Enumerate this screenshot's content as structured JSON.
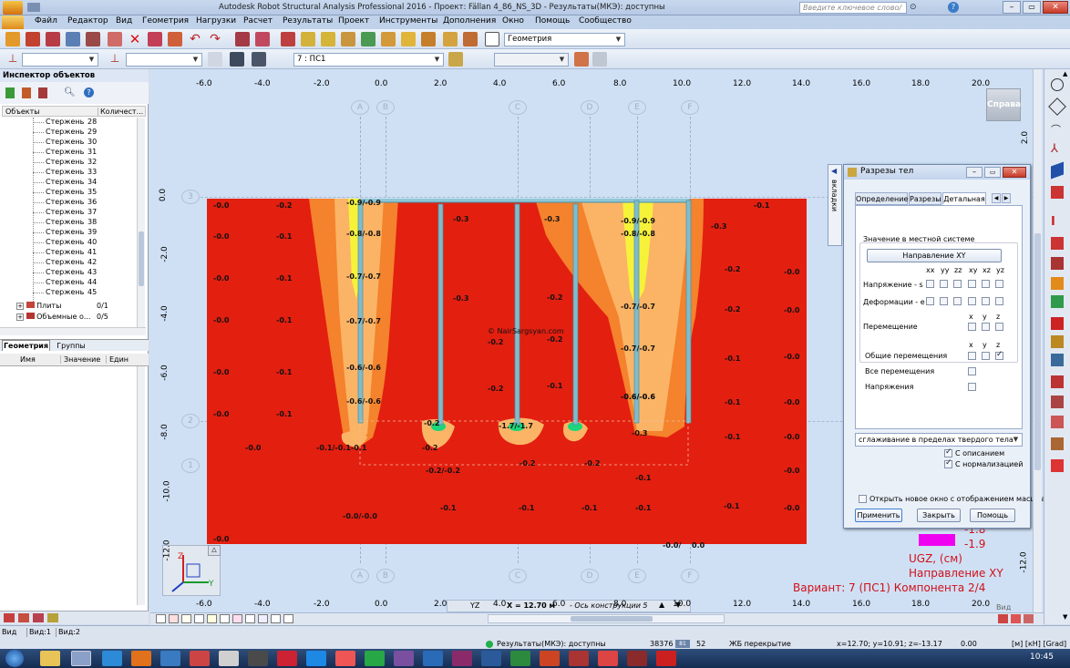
{
  "window": {
    "title": "Autodesk Robot Structural Analysis Professional 2016 - Проект: Fällan 4_86_NS_3D - Результаты(МКЭ): доступны",
    "help_placeholder": "Введите ключевое слово/фразу"
  },
  "menu": [
    "Файл",
    "Редактор",
    "Вид",
    "Геометрия",
    "Нагрузки",
    "Расчет",
    "Результаты",
    "Проект",
    "Инструменты",
    "Дополнения",
    "Окно",
    "Помощь",
    "Сообщество"
  ],
  "toolbar": {
    "layout_combo": "Геометрия",
    "case_combo": "7 : ПС1"
  },
  "inspector": {
    "title": "Инспектор объектов",
    "col_objects": "Объекты",
    "col_count": "Количест...",
    "bars": [
      {
        "label": "Стержень",
        "num": "28"
      },
      {
        "label": "Стержень",
        "num": "29"
      },
      {
        "label": "Стержень",
        "num": "30"
      },
      {
        "label": "Стержень",
        "num": "31"
      },
      {
        "label": "Стержень",
        "num": "32"
      },
      {
        "label": "Стержень",
        "num": "33"
      },
      {
        "label": "Стержень",
        "num": "34"
      },
      {
        "label": "Стержень",
        "num": "35"
      },
      {
        "label": "Стержень",
        "num": "36"
      },
      {
        "label": "Стержень",
        "num": "37"
      },
      {
        "label": "Стержень",
        "num": "38"
      },
      {
        "label": "Стержень",
        "num": "39"
      },
      {
        "label": "Стержень",
        "num": "40"
      },
      {
        "label": "Стержень",
        "num": "41"
      },
      {
        "label": "Стержень",
        "num": "42"
      },
      {
        "label": "Стержень",
        "num": "43"
      },
      {
        "label": "Стержень",
        "num": "44"
      },
      {
        "label": "Стержень",
        "num": "45"
      }
    ],
    "plates": {
      "label": "Плиты",
      "count": "0/1"
    },
    "solids": {
      "label": "Объемные о...",
      "count": "0/5"
    },
    "tab_geometry": "Геометрия",
    "tab_groups": "Группы",
    "prop_name": "Имя",
    "prop_value": "Значение",
    "prop_unit": "Един"
  },
  "viewport": {
    "top_ticks": [
      "-6.0",
      "-4.0",
      "-2.0",
      "0.0",
      "2.0",
      "4.0",
      "6.0",
      "8.0",
      "10.0",
      "12.0",
      "14.0",
      "16.0",
      "18.0",
      "20.0"
    ],
    "bottom_ticks": [
      "-6.0",
      "-4.0",
      "-2.0",
      "0.0",
      "2.0",
      "4.0",
      "6.0",
      "8.0",
      "10.0",
      "12.0",
      "14.0",
      "16.0",
      "18.0",
      "20.0"
    ],
    "left_ticks": [
      "0.0",
      "-2.0",
      "-4.0",
      "-6.0",
      "-8.0",
      "-10.0",
      "-12.0"
    ],
    "right_ticks": [
      "2.0",
      "-12.0"
    ],
    "grid_letters": [
      "A",
      "B",
      "C",
      "D",
      "E",
      "F"
    ],
    "grid_numbers": [
      "3",
      "2",
      "1"
    ],
    "view_cube": "Справа",
    "watermark": "© NairSargsyan.com",
    "status_plane": "YZ",
    "status_x": "X = 12.70 м",
    "status_axis": "- Ось конструкции 5",
    "view_label": "Вид",
    "values": [
      "-0.0",
      "-0.2",
      "-0.9/-0.9",
      "-0.3",
      "-0.3",
      "-0.9/-0.9",
      "-0.3",
      "-0.1",
      "-0.0",
      "-0.1",
      "-0.8/-0.8",
      "-0.8/-0.8",
      "-0.2",
      "-0.0",
      "-0.0",
      "-0.1",
      "-0.7/-0.7",
      "-0.3",
      "-0.2",
      "-0.7/-0.7",
      "-0.2",
      "-0.0",
      "-0.0",
      "-0.1",
      "-0.7/-0.7",
      "-0.2",
      "-0.2",
      "-0.7/-0.7",
      "-0.1",
      "-0.0",
      "-0.0",
      "-0.1",
      "-0.6/-0.6",
      "-0.2",
      "-0.1",
      "-0.6/-0.6",
      "-0.1",
      "-0.0",
      "-0.0",
      "-0.1",
      "-0.6/-0.6",
      "-0.2",
      "-0.6/-0.6",
      "-0.1",
      "-0.0",
      "-0.0",
      "-0.1/-0.1-0.1",
      "-0.2",
      "-1.7/-1.7",
      "-0.3",
      "-0.0",
      "-0.2/-0.2",
      "-0.2",
      "-0.2",
      "-0.1",
      "-0.1",
      "-0.1",
      "-0.1",
      "-0.1",
      "-0.1",
      "-0.0",
      "-0.0",
      "-0.0/-0.0",
      "-0.0/",
      "0.0"
    ]
  },
  "panel_tab": "вкладки",
  "dialog": {
    "title": "Разрезы тел",
    "tabs": [
      "Определение",
      "Разрезы",
      "Детальная"
    ],
    "local_system": "Значение в местной системе",
    "direction_button": "Направление XY",
    "col_xx": "xx",
    "col_yy": "yy",
    "col_zz": "zz",
    "col_xy": "xy",
    "col_xz": "xz",
    "col_yz": "yz",
    "stress_label": "Напряжение - s",
    "strain_label": "Деформации - e",
    "disp_label": "Перемещение",
    "col_x": "x",
    "col_y": "y",
    "col_z": "z",
    "global_disp": "Общие перемещения",
    "all_disp": "Все перемещения",
    "stresses": "Напряжения",
    "smoothing": "сглаживание в пределах твердого тела",
    "with_description": "С описанием",
    "with_normalization": "С нормализацией",
    "open_new_window": "Открыть новое окно с отображением масштаб",
    "apply": "Применить",
    "close": "Закрыть",
    "help": "Помощь"
  },
  "legend": {
    "val1": "-1.8",
    "val2": "-1.9",
    "line1": "UGZ, (см)",
    "line2": "Направление XY",
    "line3": "Вариант: 7 (ПС1) Компонента 2/4"
  },
  "view_tabs": [
    "Вид",
    "Вид:1",
    "Вид:2"
  ],
  "status": {
    "results": "Результаты(МКЭ): доступны",
    "n1": "38376",
    "n2": "52",
    "material": "ЖБ перекрытие",
    "coords": "x=12.70; y=10.91; z=-13.17",
    "angle": "0.00",
    "units": "[м] [кН] [Grad]"
  },
  "clock": "10:45",
  "colors": {
    "stress_bg": "#e31f10",
    "orange": "#f5822c",
    "light_orange": "#fbb466",
    "yellow": "#f6f23a",
    "green": "#1bd67a",
    "pile": "#7fbccc",
    "legend_magenta": "#f000f0"
  }
}
